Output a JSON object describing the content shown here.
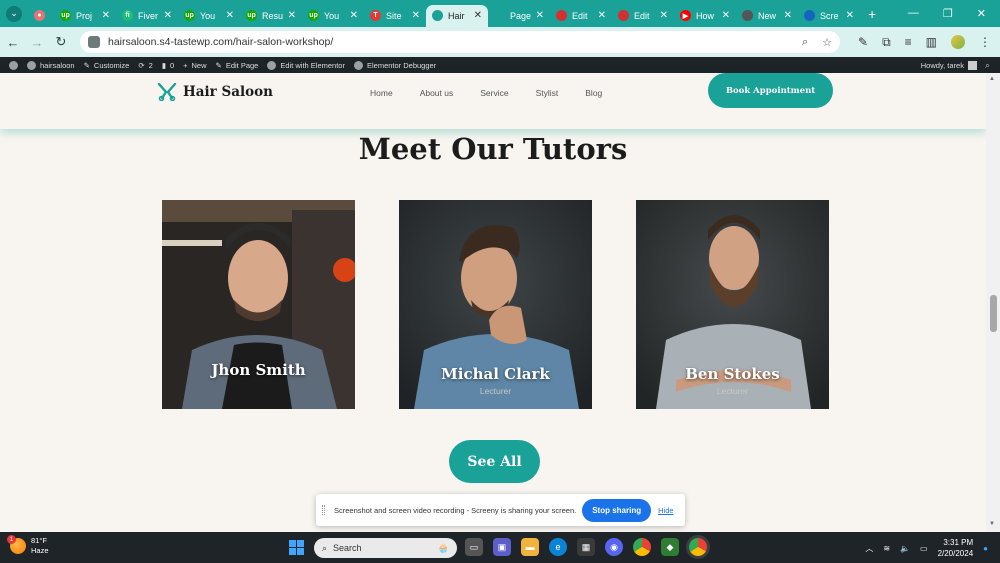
{
  "browser": {
    "tabs": [
      {
        "label": "Proj",
        "fav_color": "#14a800",
        "fav_text": "up"
      },
      {
        "label": "Fiver",
        "fav_color": "#1dbf73",
        "fav_text": "fi"
      },
      {
        "label": "You",
        "fav_color": "#14a800",
        "fav_text": "up"
      },
      {
        "label": "Resu",
        "fav_color": "#14a800",
        "fav_text": "up"
      },
      {
        "label": "You",
        "fav_color": "#14a800",
        "fav_text": "up"
      },
      {
        "label": "Site",
        "fav_color": "#e53935",
        "fav_text": "T"
      },
      {
        "label": "Hair",
        "fav_color": "#1aa198",
        "fav_text": "",
        "active": true
      },
      {
        "label": "Page",
        "fav_color": "#1aa198",
        "fav_text": ""
      },
      {
        "label": "Edit",
        "fav_color": "#d32f2f",
        "fav_text": ""
      },
      {
        "label": "Edit",
        "fav_color": "#d32f2f",
        "fav_text": ""
      },
      {
        "label": "How",
        "fav_color": "#ff0000",
        "fav_text": "▶"
      },
      {
        "label": "New",
        "fav_color": "#555555",
        "fav_text": ""
      },
      {
        "label": "Scre",
        "fav_color": "#1565c0",
        "fav_text": ""
      }
    ],
    "url": "hairsaloon.s4-tastewp.com/hair-salon-workshop/"
  },
  "wpbar": {
    "site": "hairsaloon",
    "customize": "Customize",
    "updates": "2",
    "comments": "0",
    "new": "New",
    "edit_page": "Edit Page",
    "edit_elementor": "Edit with Elementor",
    "debugger": "Elementor Debugger",
    "howdy": "Howdy, tarek"
  },
  "header": {
    "logo": "Hair Saloon",
    "menu": [
      "Home",
      "About us",
      "Service",
      "Stylist",
      "Blog"
    ],
    "book": "Book Appointment"
  },
  "section": {
    "title": "Meet Our Tutors",
    "see_all": "See All"
  },
  "tutors": [
    {
      "name": "Jhon Smith",
      "role": ""
    },
    {
      "name": "Michal Clark",
      "role": "Lecturer"
    },
    {
      "name": "Ben Stokes",
      "role": "Lecturer"
    }
  ],
  "share_banner": {
    "text": "Screenshot and screen video recording - Screeny is sharing your screen.",
    "stop": "Stop sharing",
    "hide": "Hide"
  },
  "taskbar": {
    "temp": "81°F",
    "condition": "Haze",
    "weather_badge": "1",
    "search": "Search",
    "time": "3:31 PM",
    "date": "2/20/2024"
  },
  "colors": {
    "accent": "#1aa198",
    "blue": "#1a73e8"
  }
}
